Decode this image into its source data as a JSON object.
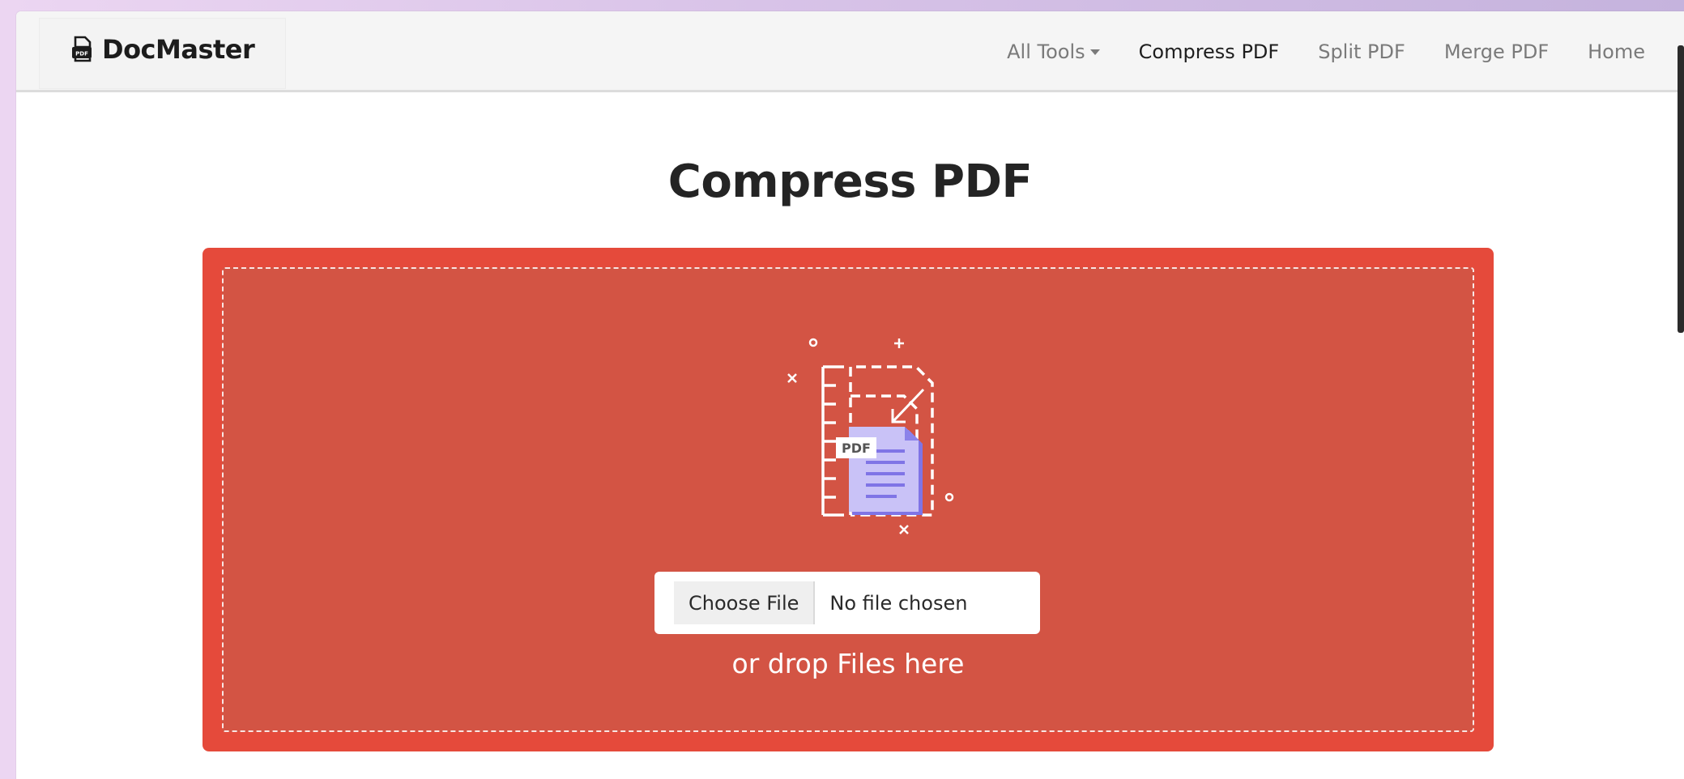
{
  "app": {
    "brand_name": "DocMaster",
    "brand_icon": "pdf-file-icon"
  },
  "nav": {
    "items": [
      {
        "label": "All Tools",
        "dropdown": true,
        "active": false
      },
      {
        "label": "Compress PDF",
        "dropdown": false,
        "active": true
      },
      {
        "label": "Split PDF",
        "dropdown": false,
        "active": false
      },
      {
        "label": "Merge PDF",
        "dropdown": false,
        "active": false
      },
      {
        "label": "Home",
        "dropdown": false,
        "active": false
      }
    ]
  },
  "main": {
    "title": "Compress PDF",
    "illustration_label": "PDF",
    "illustration_icon": "compress-pdf-icon",
    "file_input": {
      "button_label": "Choose File",
      "status": "No file chosen"
    },
    "drop_hint": "or drop Files here"
  },
  "colors": {
    "drop_zone_border": "#e54a3b",
    "drop_zone_fill": "#d35444",
    "document_fill": "#c9c2f7",
    "document_lines": "#7f74e6"
  }
}
